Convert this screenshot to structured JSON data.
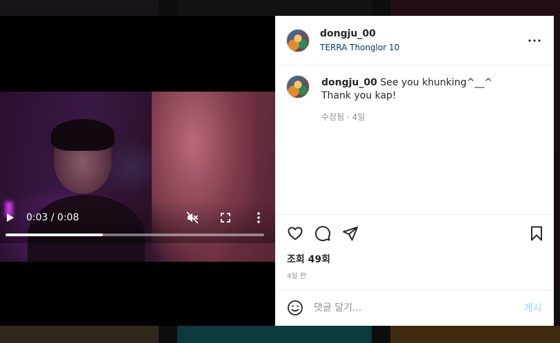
{
  "post": {
    "username": "dongju_00",
    "location": "TERRA Thonglor 10"
  },
  "video": {
    "time_display": "0:03 / 0:08",
    "progress": 0.375
  },
  "comment": {
    "username": "dongju_00",
    "text_line1": "See you khunking^__^",
    "text_line2": "Thank you kap!",
    "meta": "수정됨 · 4일"
  },
  "stats": {
    "views": "조회 49회",
    "posted_ago": "4일 전"
  },
  "comment_box": {
    "placeholder": "댓글 달기...",
    "post_label": "게시"
  },
  "icons": {
    "play": "play-icon",
    "mute": "muted-speaker-icon",
    "fullscreen": "fullscreen-icon",
    "video_more": "vertical-dots-icon",
    "more": "horizontal-dots-icon",
    "like": "heart-icon",
    "comment": "comment-bubble-icon",
    "share": "paper-plane-icon",
    "save": "bookmark-icon",
    "emoji": "emoji-icon"
  },
  "colors": {
    "link": "#00376b",
    "post_button_disabled": "#b2dffc",
    "secondary_text": "#8e8e8e"
  }
}
